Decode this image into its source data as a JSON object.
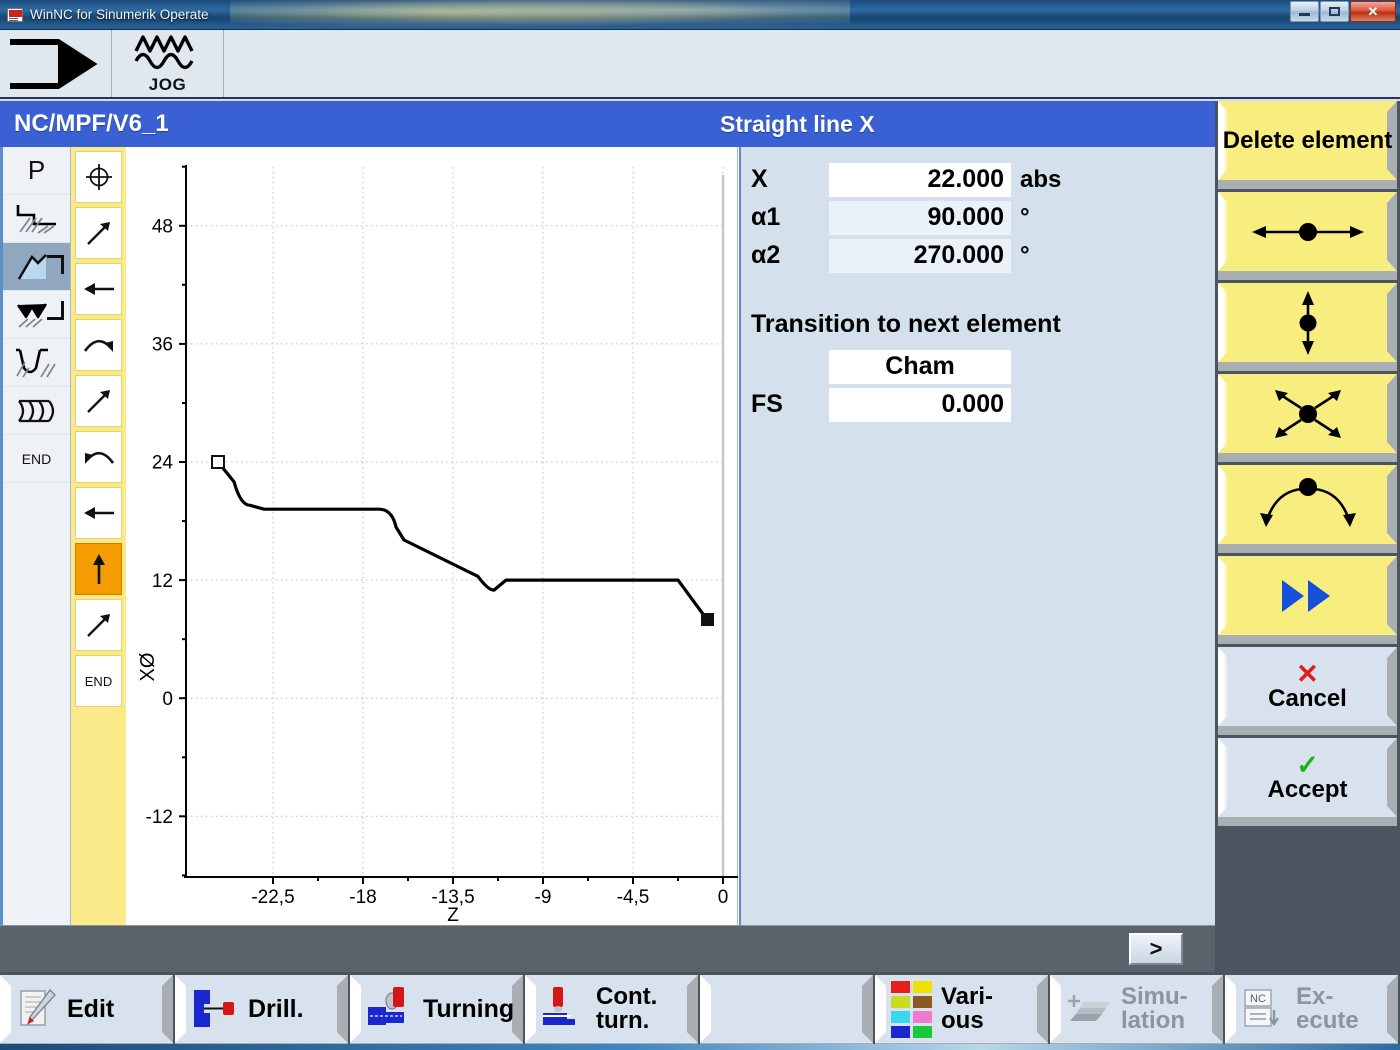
{
  "window": {
    "title": "WinNC for Sinumerik Operate",
    "icon": "winnc-logo-icon",
    "buttons": {
      "minimize": "minimize-icon",
      "maximize": "maximize-icon",
      "close": "✕"
    }
  },
  "modebar": {
    "items": [
      {
        "name": "machine-area-icon",
        "label": ""
      },
      {
        "name": "jog-mode-icon",
        "label": "JOG"
      }
    ]
  },
  "header": {
    "path": "NC/MPF/V6_1",
    "element_title": "Straight line X"
  },
  "type_column": {
    "items": [
      {
        "name": "program-p",
        "label": "P"
      },
      {
        "name": "stock-removal-icon",
        "label": ""
      },
      {
        "name": "contour-icon",
        "label": "",
        "selected": true
      },
      {
        "name": "residual-material-icon",
        "label": ""
      },
      {
        "name": "groove-icon",
        "label": ""
      },
      {
        "name": "thread-icon",
        "label": ""
      },
      {
        "name": "end-marker",
        "label": "END"
      }
    ]
  },
  "element_column": {
    "items": [
      {
        "name": "start-point-icon",
        "label": "",
        "active": false
      },
      {
        "name": "line-diagonal-icon",
        "label": "",
        "active": false
      },
      {
        "name": "line-left-icon",
        "label": "",
        "active": false
      },
      {
        "name": "arc-cw-icon",
        "label": "",
        "active": false
      },
      {
        "name": "line-diagonal-icon",
        "label": "",
        "active": false
      },
      {
        "name": "arc-ccw-icon",
        "label": "",
        "active": false
      },
      {
        "name": "line-left-icon",
        "label": "",
        "active": false
      },
      {
        "name": "line-up-icon",
        "label": "",
        "active": true
      },
      {
        "name": "line-diagonal-icon",
        "label": "",
        "active": false
      },
      {
        "name": "end-element",
        "label": "END",
        "active": false
      }
    ]
  },
  "parameters": {
    "rows": [
      {
        "label": "X",
        "value": "22.000",
        "unit": "abs",
        "highlight": true
      },
      {
        "label": "α1",
        "value": "90.000",
        "unit": "°",
        "highlight": false
      },
      {
        "label": "α2",
        "value": "270.000",
        "unit": "°",
        "highlight": false
      }
    ],
    "transition_title": "Transition to next element",
    "transition_value": "Cham",
    "fs_label": "FS",
    "fs_value": "0.000"
  },
  "statusbar": {
    "forward_label": ">"
  },
  "softkeys_vertical": [
    {
      "name": "delete-element-softkey",
      "label": "Delete element",
      "icon": "",
      "style": "yellow"
    },
    {
      "name": "move-horizontal-softkey",
      "label": "",
      "icon": "arrow-horizontal-icon",
      "style": "yellow"
    },
    {
      "name": "move-vertical-softkey",
      "label": "",
      "icon": "arrow-vertical-icon",
      "style": "yellow"
    },
    {
      "name": "move-diagonal-softkey",
      "label": "",
      "icon": "arrows-diagonal-cross-icon",
      "style": "yellow"
    },
    {
      "name": "move-arc-softkey",
      "label": "",
      "icon": "arrows-arc-icon",
      "style": "yellow"
    },
    {
      "name": "fast-forward-softkey",
      "label": "",
      "icon": "double-arrow-right-icon",
      "style": "yellow"
    },
    {
      "name": "cancel-softkey",
      "label": "Cancel",
      "icon": "red-x-icon",
      "style": "plain"
    },
    {
      "name": "accept-softkey",
      "label": "Accept",
      "icon": "green-check-icon",
      "style": "plain"
    }
  ],
  "softkeys_bottom": [
    {
      "name": "edit-softkey",
      "label": "Edit",
      "icon": "edit-pencil-icon",
      "enabled": true
    },
    {
      "name": "drill-softkey",
      "label": "Drill.",
      "icon": "drill-icon",
      "enabled": true
    },
    {
      "name": "turning-softkey",
      "label": "Turning",
      "icon": "turning-icon",
      "enabled": true
    },
    {
      "name": "contour-turning-softkey",
      "label_line1": "Cont.",
      "label_line2": "turn.",
      "icon": "contour-turn-icon",
      "enabled": true
    },
    {
      "name": "empty-softkey",
      "label": "",
      "icon": "",
      "enabled": true
    },
    {
      "name": "various-softkey",
      "label_line1": "Vari-",
      "label_line2": "ous",
      "icon": "color-swatches-icon",
      "enabled": true
    },
    {
      "name": "simulation-softkey",
      "label_line1": "Simu-",
      "label_line2": "lation",
      "icon": "simulation-icon",
      "enabled": false
    },
    {
      "name": "execute-softkey",
      "label_line1": "Ex-",
      "label_line2": "ecute",
      "icon": "nc-execute-icon",
      "enabled": false
    }
  ],
  "swatch_colors": [
    "#e81e1e",
    "#f2e000",
    "#c8dd22",
    "#8a5a22",
    "#39d6ef",
    "#f07ad0",
    "#1a27cf",
    "#18c838"
  ],
  "colors": {
    "header_blue": "#3a61d4",
    "panel_bg": "#d4e0ec",
    "softkey_yellow": "#f8ee80",
    "softkey_gray": "#4a5560",
    "active_orange": "#f59c00",
    "list_yellow": "#fbea8a"
  },
  "chart_data": {
    "type": "line",
    "title": "",
    "xlabel": "Z",
    "ylabel": "XØ",
    "xlim": [
      -25.6,
      1.4
    ],
    "ylim": [
      -18.5,
      54.0
    ],
    "xticks": [
      -22.5,
      -18,
      -13.5,
      -9,
      -4.5,
      0
    ],
    "xtick_labels": [
      "-22,5",
      "-18",
      "-13,5",
      "-9",
      "-4,5",
      "0"
    ],
    "yticks": [
      48,
      36,
      24,
      12,
      0,
      -12
    ],
    "ytick_labels": [
      "48",
      "36",
      "24",
      "12",
      "0",
      "-12"
    ],
    "grid": true,
    "grid_style": "dotted",
    "reference_line_z": 0,
    "start_marker": {
      "z": -24.0,
      "x": 24.0,
      "style": "hollow-square"
    },
    "end_marker": {
      "z": -0.8,
      "x": 8.0,
      "style": "filled-square"
    },
    "series": [
      {
        "name": "contour",
        "points": [
          {
            "z": -24.0,
            "x": 24.0
          },
          {
            "z": -23.2,
            "x": 22.0
          },
          {
            "z": -22.6,
            "x": 19.6
          },
          {
            "z": -21.8,
            "x": 19.2
          },
          {
            "z": -16.0,
            "x": 19.2
          },
          {
            "z": -15.3,
            "x": 18.6
          },
          {
            "z": -14.9,
            "x": 17.3
          },
          {
            "z": -11.2,
            "x": 13.6
          },
          {
            "z": -10.6,
            "x": 12.4
          },
          {
            "z": -10.0,
            "x": 12.0
          },
          {
            "z": -2.2,
            "x": 12.0
          },
          {
            "z": -0.8,
            "x": 8.0
          }
        ]
      }
    ]
  }
}
